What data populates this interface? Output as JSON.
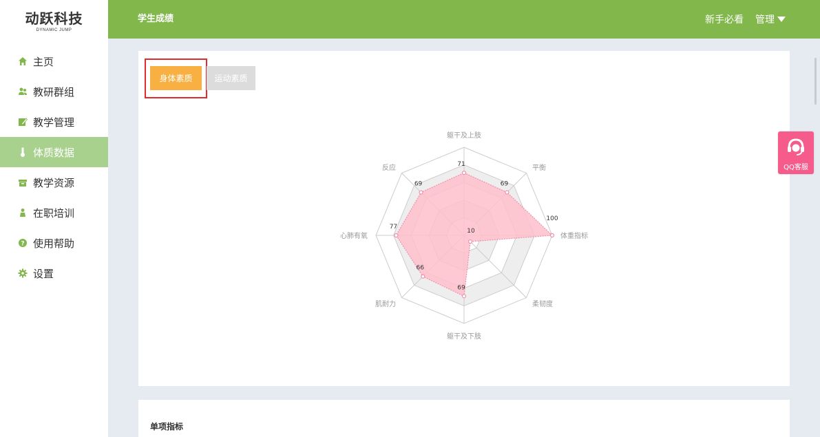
{
  "sidebar": {
    "logo_main": "动跃科技",
    "logo_sub": "DYNAMIC JUMP",
    "items": [
      {
        "label": "主页",
        "icon": "home-icon"
      },
      {
        "label": "教研群组",
        "icon": "users-icon"
      },
      {
        "label": "教学管理",
        "icon": "edit-icon"
      },
      {
        "label": "体质数据",
        "icon": "thermometer-icon",
        "active": true
      },
      {
        "label": "教学资源",
        "icon": "box-icon"
      },
      {
        "label": "在职培训",
        "icon": "person-icon"
      },
      {
        "label": "使用帮助",
        "icon": "help-icon"
      },
      {
        "label": "设置",
        "icon": "gear-icon"
      }
    ]
  },
  "header": {
    "title": "学生成绩",
    "guide": "新手必看",
    "manage": "管理"
  },
  "tabs": {
    "active": "身体素质",
    "inactive": "运动素质"
  },
  "section2": {
    "title": "单项指标"
  },
  "qq": {
    "label": "QQ客服"
  },
  "colors": {
    "header": "#82b74b",
    "sidebar_active": "#a9d18e",
    "tab_active": "#f9b042",
    "radar_fill": "#ffc0cb",
    "radar_stroke": "#f08fae",
    "qq": "#f55c8c"
  },
  "chart_data": {
    "type": "radar",
    "max": 100,
    "axes": [
      "躯干及上肢",
      "平衡",
      "体重指标",
      "柔韧度",
      "躯干及下肢",
      "肌耐力",
      "心肺有氧",
      "反应"
    ],
    "values": [
      71,
      69,
      100,
      10,
      69,
      66,
      77,
      69
    ]
  }
}
